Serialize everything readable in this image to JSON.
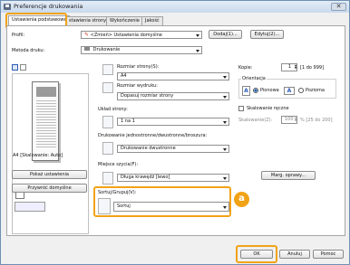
{
  "window": {
    "title": "Preferencje drukowania",
    "close": "✕"
  },
  "tabs": [
    "Ustawienia podstawowe",
    "stawienia strony",
    "Wykończenie",
    "Jakość"
  ],
  "profile": {
    "label": "Profil:",
    "value": "<Zmień> Ustawienia domyślne",
    "add": "Dodaj(1)...",
    "edit": "Edytuj(2)..."
  },
  "method": {
    "label": "Metoda druku:",
    "value": "Drukowanie"
  },
  "preview": {
    "status": "A4 [Skalowanie: Auto]"
  },
  "page_size": {
    "label": "Rozmiar strony(S):",
    "value": "A4"
  },
  "output_size": {
    "label": "Rozmiar wydruku:",
    "value": "Dopasuj rozmiar strony"
  },
  "layout": {
    "label": "Układ strony:",
    "value": "1 na 1"
  },
  "duplex": {
    "label": "Drukowanie jednostronne/dwustronne/broszura:",
    "value": "Drukowanie dwustronne"
  },
  "binding": {
    "label": "Miejsce szycia(F):",
    "value": "Długa krawędź [lewo]"
  },
  "sort": {
    "label": "Sortuj/Grupuj(V):",
    "value": "Sortuj"
  },
  "copies": {
    "label": "Kopie:",
    "value": "1",
    "range": "[1 do 999]"
  },
  "orientation": {
    "label": "Orientacja",
    "portrait": "Pionowa",
    "landscape": "Pozioma"
  },
  "manual_scaling": {
    "label": "Skalowanie ręczne",
    "scale_label": "Skalowanie(Z):",
    "scale_value": "100",
    "scale_range": "% [25 do 200]"
  },
  "margin_button": "Marg. oprawy...",
  "show_settings": "Pokaż ustawienia",
  "restore_defaults": "Przywróć domyślne",
  "footer": {
    "ok": "OK",
    "cancel": "Anuluj",
    "help": "Pomoc"
  },
  "callout": "a",
  "colors": {
    "highlight": "#f1a317",
    "selected": "#c8def6"
  }
}
